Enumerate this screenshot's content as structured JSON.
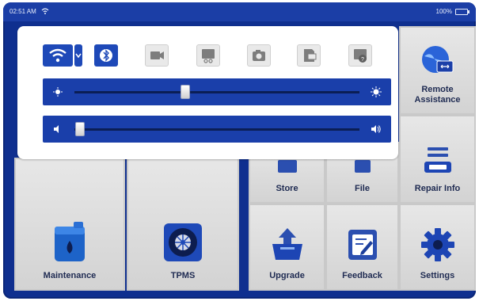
{
  "status_bar": {
    "time": "02:51 AM",
    "battery": "100%"
  },
  "quick_panel": {
    "brightness_level": 0.39,
    "volume_level": 0.02
  },
  "tiles": {
    "remote_assistance": "Remote Assistance",
    "store": "Store",
    "file": "File",
    "repair_info": "Repair Info",
    "maintenance": "Maintenance",
    "tpms": "TPMS",
    "upgrade": "Upgrade",
    "feedback": "Feedback",
    "settings": "Settings"
  },
  "colors": {
    "device_bg": "#0f2f8f",
    "panel_bg": "#ffffff",
    "accent": "#1e49b8",
    "tile_text": "#1f2b52"
  },
  "icons": [
    "wifi-icon",
    "dropdown-arrow-icon",
    "bluetooth-icon",
    "screen-record-icon",
    "screenshot-icon",
    "camera-icon",
    "sd-card-icon",
    "help-icon",
    "brightness-low-icon",
    "brightness-high-icon",
    "volume-low-icon",
    "volume-high-icon"
  ]
}
